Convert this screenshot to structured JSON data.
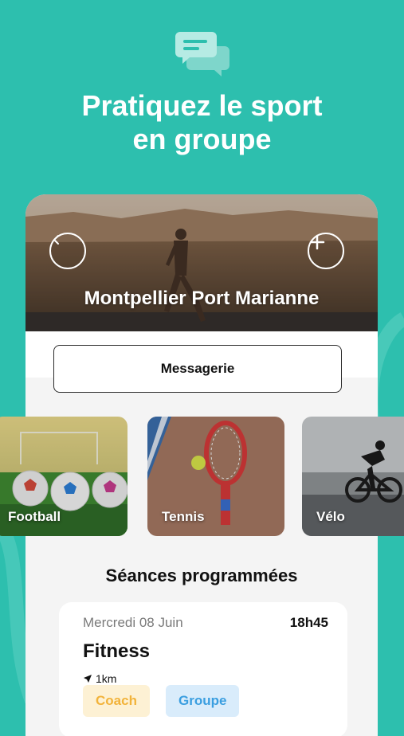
{
  "promo": {
    "headline_line1": "Pratiquez le sport",
    "headline_line2": "en groupe",
    "icon": "chat-bubbles-icon"
  },
  "hero": {
    "title": "Montpellier Port Marianne",
    "back_icon": "chevron-left-icon",
    "add_icon": "plus-icon"
  },
  "messaging": {
    "label": "Messagerie"
  },
  "sports": [
    {
      "label": "Football"
    },
    {
      "label": "Tennis"
    },
    {
      "label": "Vélo"
    }
  ],
  "sessions": {
    "title": "Séances programmées",
    "items": [
      {
        "date": "Mercredi 08 Juin",
        "time": "18h45",
        "name": "Fitness",
        "distance": "1km",
        "tags": [
          "Coach",
          "Groupe"
        ]
      }
    ]
  },
  "colors": {
    "background": "#2dbfae",
    "coach_tag_text": "#f2b33a",
    "coach_tag_bg": "#fdf1d4",
    "groupe_tag_text": "#3a9ee0",
    "groupe_tag_bg": "#d9ecfb"
  }
}
